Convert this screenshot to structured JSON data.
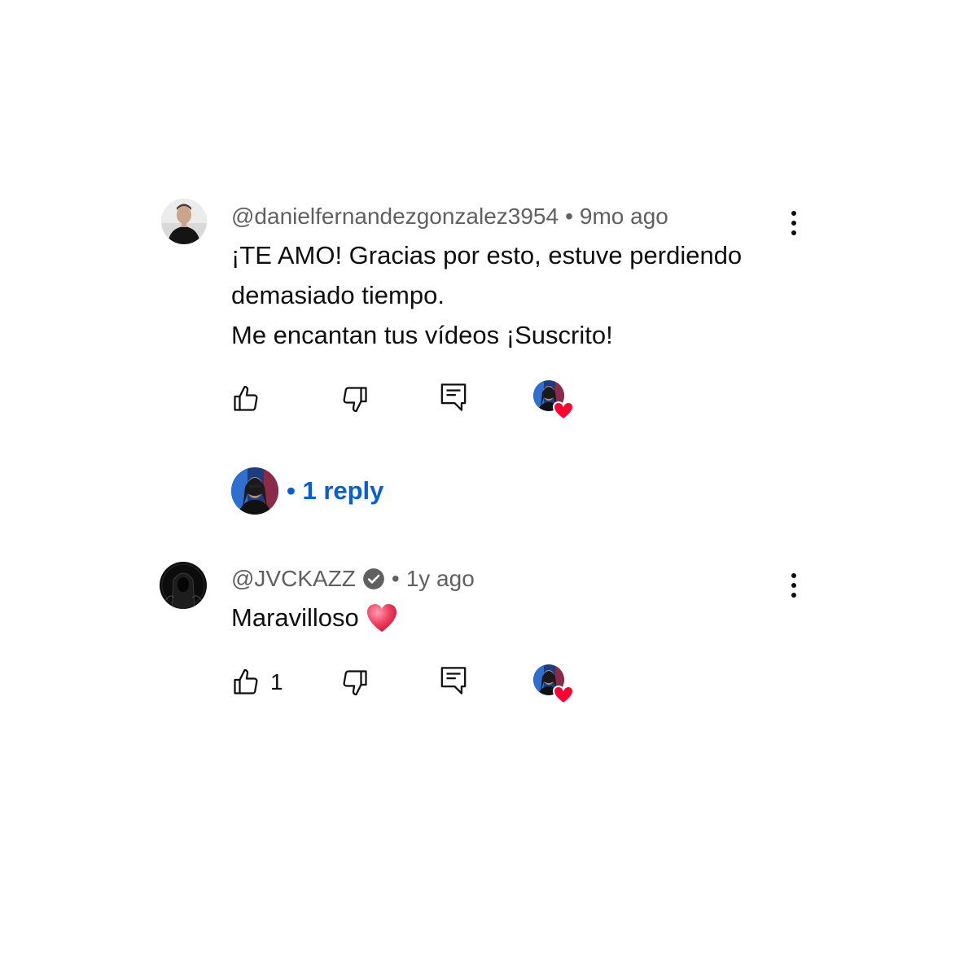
{
  "comments": [
    {
      "author": "@danielfernandezgonzalez3954",
      "separator": "•",
      "time": "9mo ago",
      "lines": [
        "¡TE AMO! Gracias por esto, estuve perdiendo",
        "demasiado tiempo.",
        "Me encantan tus vídeos ¡Suscrito!"
      ],
      "like_count": "",
      "creator_heart": true,
      "replies_label": "• 1 reply"
    },
    {
      "author": "@JVCKAZZ",
      "verified": true,
      "separator": "•",
      "time": "1y ago",
      "text": "Maravilloso",
      "emoji": "heart",
      "like_count": "1",
      "creator_heart": true
    }
  ],
  "colors": {
    "meta_text": "#606060",
    "body_text": "#0f0f0f",
    "reply_link": "#065fd4",
    "heart": "#ff0033"
  },
  "icons": [
    "like-icon",
    "dislike-icon",
    "reply-icon",
    "more-vertical-icon",
    "verified-icon",
    "heart-icon"
  ]
}
